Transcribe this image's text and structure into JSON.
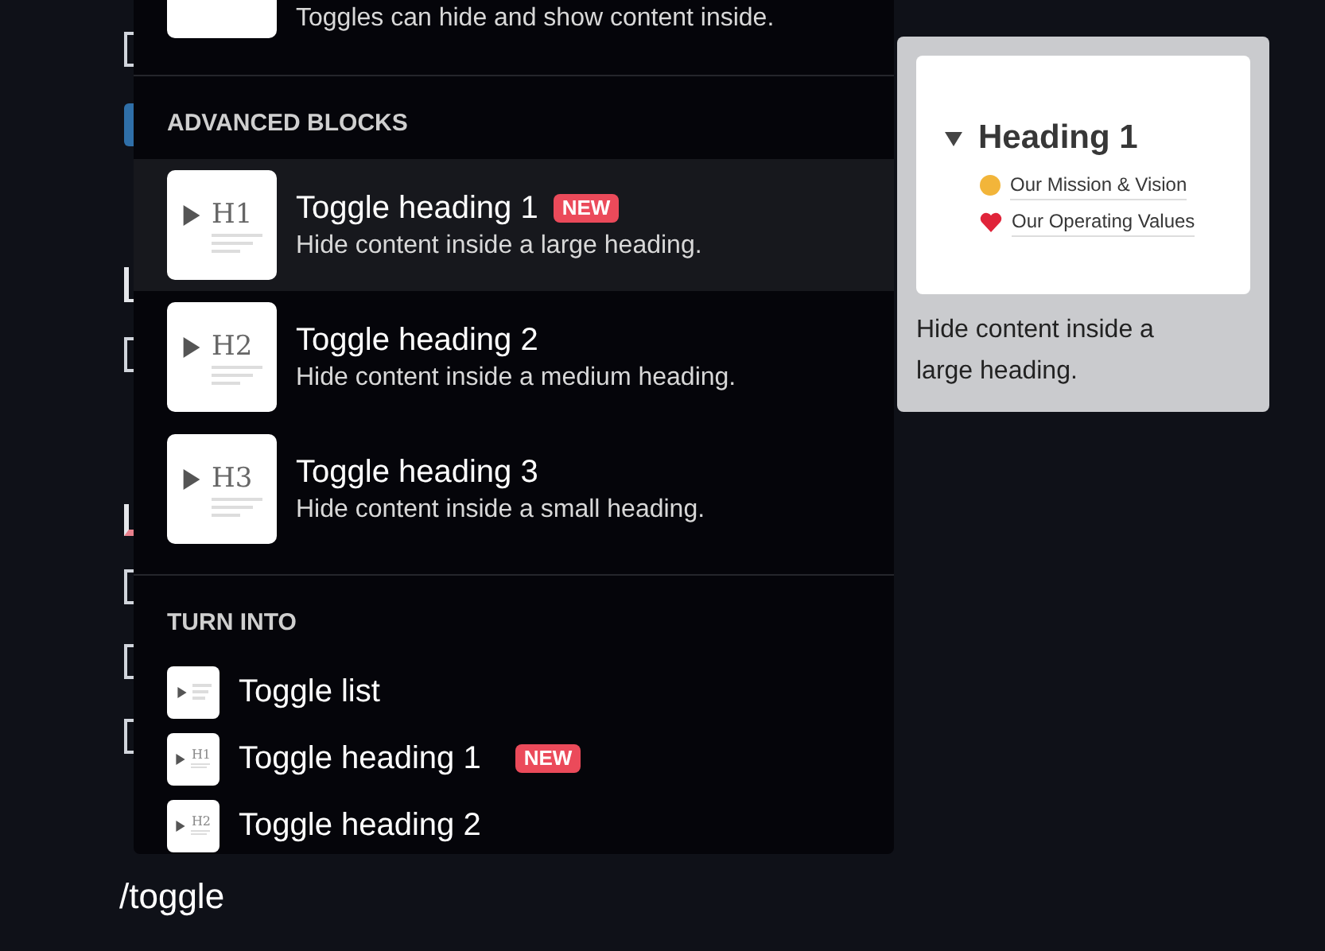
{
  "editor": {
    "fragments": [
      {
        "kind": "bracket"
      },
      {
        "kind": "block"
      },
      {
        "kind": "link"
      },
      {
        "kind": "bracket"
      },
      {
        "kind": "misspelled"
      },
      {
        "kind": "bracket"
      },
      {
        "kind": "bracket"
      },
      {
        "kind": "bracket"
      }
    ],
    "input": "/toggle"
  },
  "menu": {
    "top_item": {
      "description": "Toggles can hide and show content inside."
    },
    "sections": [
      {
        "title": "ADVANCED BLOCKS",
        "kind": "detailed",
        "items": [
          {
            "icon_label": "H1",
            "title": "Toggle heading 1",
            "badge": "NEW",
            "description": "Hide content inside a large heading.",
            "selected": true
          },
          {
            "icon_label": "H2",
            "title": "Toggle heading 2",
            "description": "Hide content inside a medium heading.",
            "selected": false
          },
          {
            "icon_label": "H3",
            "title": "Toggle heading 3",
            "description": "Hide content inside a small heading.",
            "selected": false
          }
        ]
      },
      {
        "title": "TURN INTO",
        "kind": "compact",
        "items": [
          {
            "title": "Toggle list",
            "selected": false
          },
          {
            "icon_label": "H1",
            "title": "Toggle heading 1",
            "badge": "NEW",
            "selected": false
          },
          {
            "icon_label": "H2",
            "title": "Toggle heading 2",
            "selected": false
          }
        ]
      }
    ]
  },
  "preview": {
    "heading": "Heading 1",
    "links": [
      {
        "kind": "smile",
        "text": "Our Mission & Vision"
      },
      {
        "kind": "heart",
        "text": "Our Operating Values"
      }
    ],
    "caption": "Hide content inside a large heading."
  }
}
